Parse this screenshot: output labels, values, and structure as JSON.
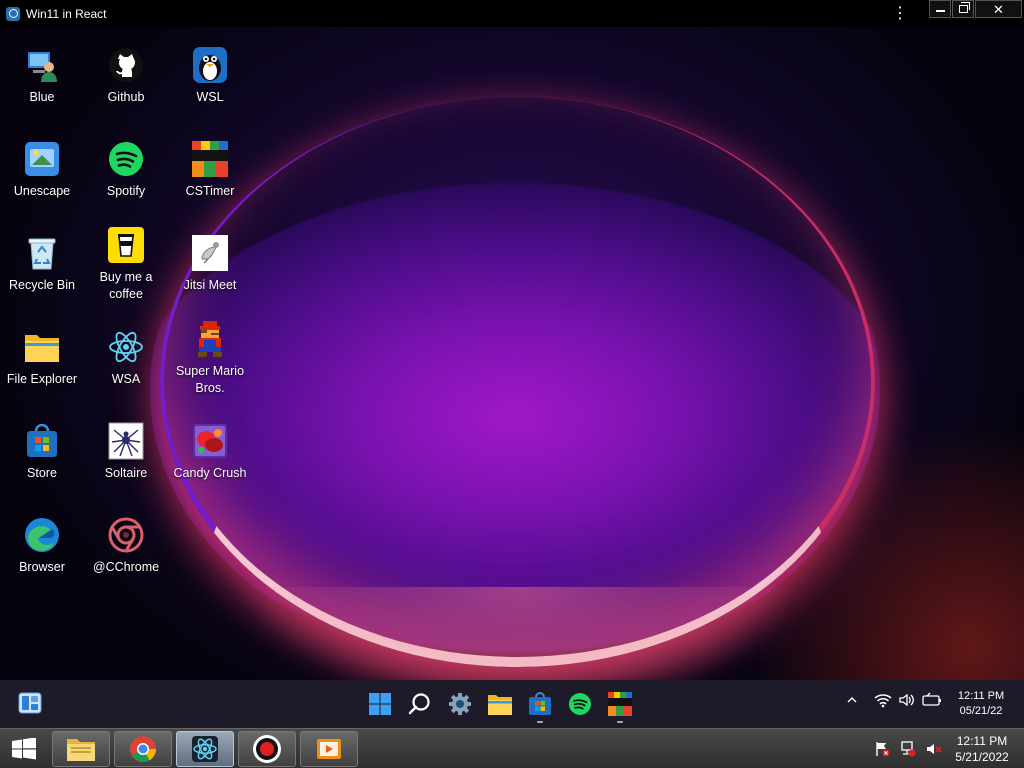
{
  "window": {
    "title": "Win11 in React",
    "menu_glyph": "⋮",
    "close_glyph": "✕"
  },
  "desktop": {
    "icons": [
      {
        "label": "Blue",
        "icon": "blue-user-icon"
      },
      {
        "label": "Unescape",
        "icon": "unescape-icon"
      },
      {
        "label": "Recycle Bin",
        "icon": "recycle-bin-icon"
      },
      {
        "label": "File Explorer",
        "icon": "folder-icon"
      },
      {
        "label": "Store",
        "icon": "store-icon"
      },
      {
        "label": "Browser",
        "icon": "edge-icon"
      },
      {
        "label": "Github",
        "icon": "github-icon"
      },
      {
        "label": "Spotify",
        "icon": "spotify-icon"
      },
      {
        "label": "Buy me a coffee",
        "icon": "coffee-icon"
      },
      {
        "label": "WSA",
        "icon": "react-icon"
      },
      {
        "label": "Soltaire",
        "icon": "spider-icon"
      },
      {
        "label": "@CChrome",
        "icon": "cchrome-icon"
      },
      {
        "label": "WSL",
        "icon": "penguin-icon"
      },
      {
        "label": "CSTimer",
        "icon": "cstimer-icon"
      },
      {
        "label": "Jitsi Meet",
        "icon": "jitsi-icon"
      },
      {
        "label": "Super Mario Bros.",
        "icon": "mario-icon"
      },
      {
        "label": "Candy Crush",
        "icon": "candy-icon"
      }
    ],
    "cstimer_text": "csTimer"
  },
  "taskbar": {
    "apps": [
      "start-icon",
      "search-icon",
      "settings-icon",
      "folder-icon",
      "store-icon",
      "spotify-icon",
      "cstimer-icon"
    ],
    "time": "12:11 PM",
    "date": "05/21/22",
    "colors": {
      "background": "#1d1b2a"
    }
  },
  "host_taskbar": {
    "time": "12:11 PM",
    "date": "5/21/2022",
    "apps": [
      "file-manager-icon",
      "chrome-icon",
      "react-app-icon",
      "record-icon",
      "media-player-icon"
    ]
  }
}
